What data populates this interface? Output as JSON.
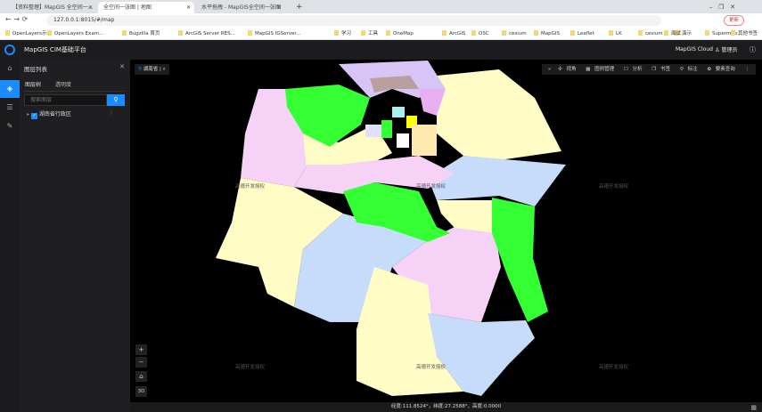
{
  "browser": {
    "tabs": [
      {
        "label": "【资料整理】MapGIS 全空间一..."
      },
      {
        "label": "全空间一张图 | 地图"
      },
      {
        "label": "水平拖拽 - MapGIS全空间一张图"
      }
    ],
    "new_tab": "+",
    "url": "127.0.0.1:8015/#/map",
    "update_button": "更新",
    "bookmarks": [
      "OpenLayers示例",
      "OpenLayers Exam...",
      "Bugzilla 首页",
      "ArcGIS Server RES...",
      "MapGIS IGServer...",
      "学习",
      "工具",
      "OneMap",
      "ArcGIS",
      "OSC",
      "cesium",
      "MapGIS",
      "Leaflet",
      "LK",
      "cesium",
      "演示",
      "Supermap",
      "面试"
    ],
    "other_bookmarks": "其他书签"
  },
  "app": {
    "title": "MapGIS CIM基础平台",
    "cloud": "MapGIS Cloud",
    "user": "管理员"
  },
  "panel": {
    "title": "图层列表",
    "tabs": [
      "图层树",
      "透明度"
    ],
    "search_placeholder": "搜索图层",
    "layers": [
      {
        "label": "湖南省行政区",
        "checked": true
      }
    ]
  },
  "map": {
    "location": "湖南省",
    "toolbar": [
      "视角",
      "图例管理",
      "分析",
      "书签",
      "标注",
      "要素查询"
    ],
    "watermark": "高德开发授权",
    "zoom_in": "+",
    "zoom_out": "−",
    "mode": "3D",
    "status": "经度:111.8524°，纬度:27.2588°，高度:0.0000"
  },
  "colors": {
    "accent": "#1a8cff",
    "green": "#33ff33",
    "yellow": "#fffcc6",
    "blue": "#c6dcfa",
    "pink": "#f7d2f7",
    "purple": "#d7c6f5"
  }
}
